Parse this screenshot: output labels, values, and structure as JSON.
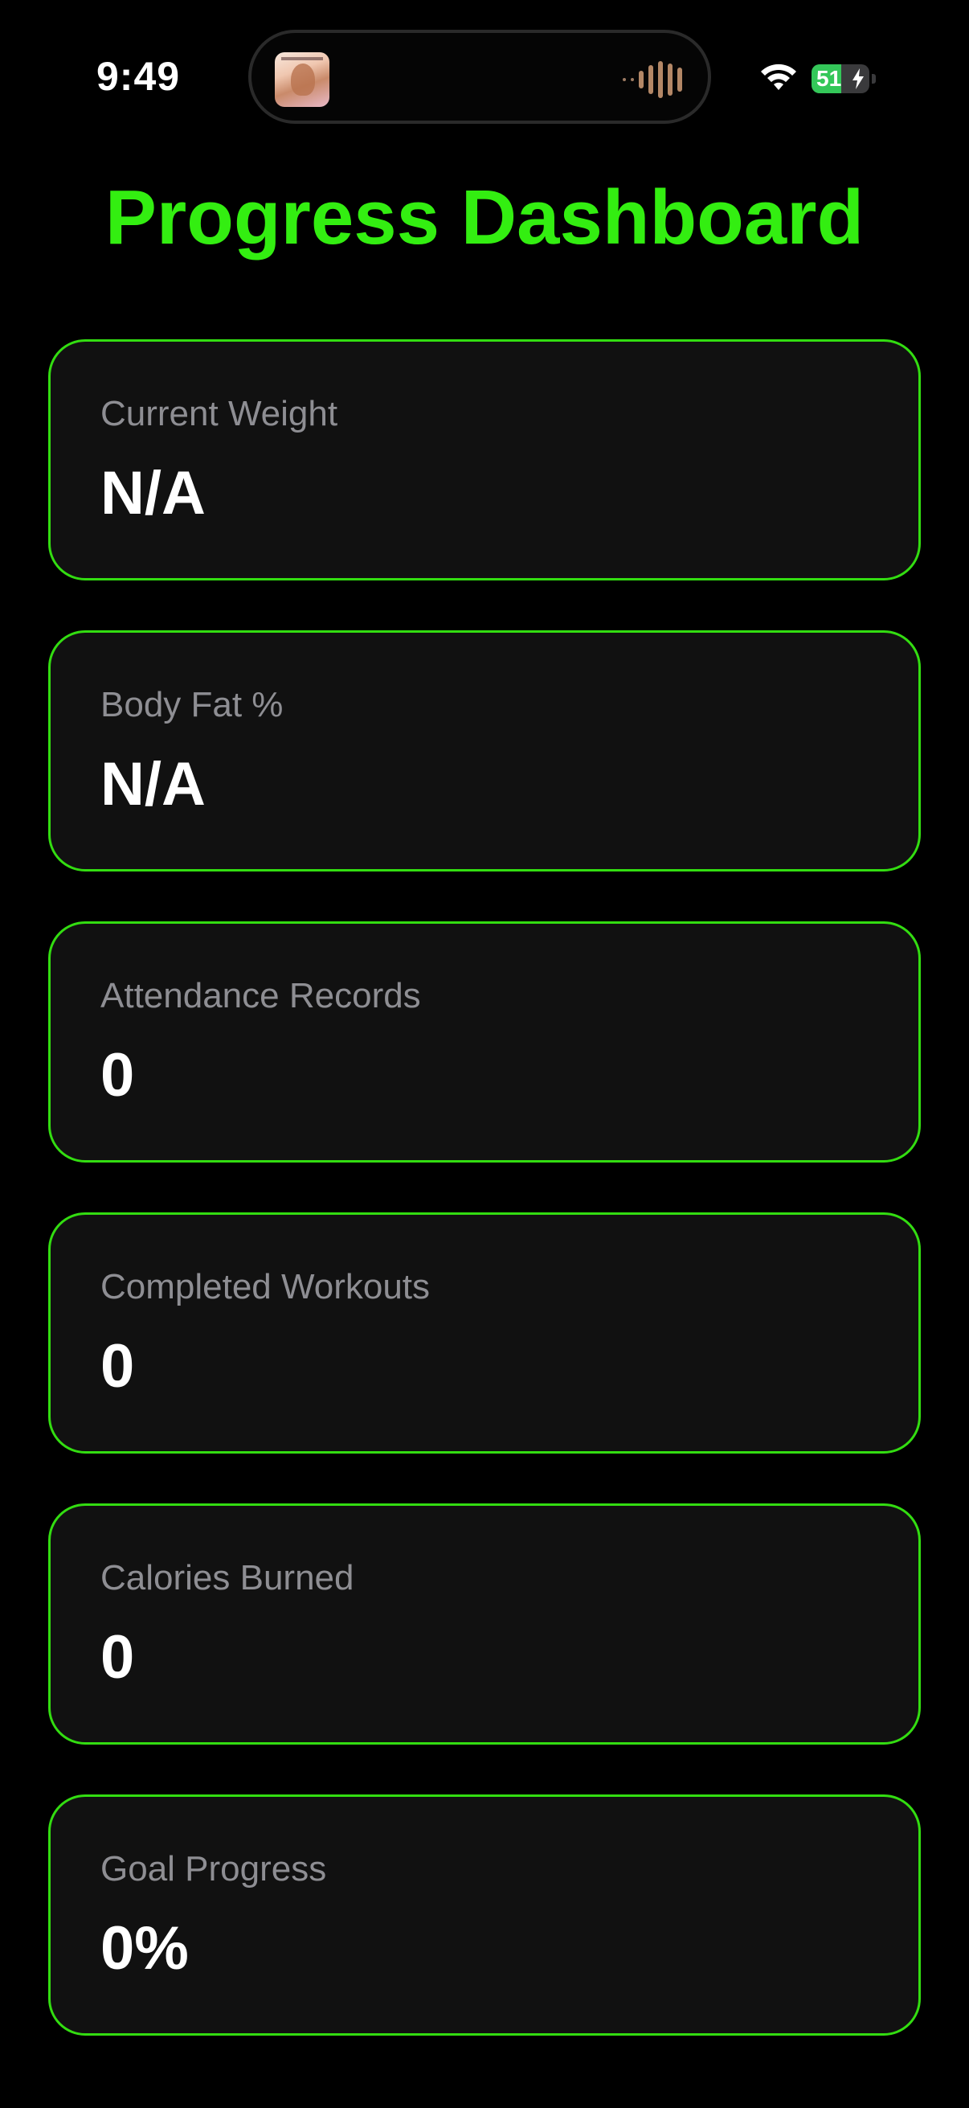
{
  "status_bar": {
    "time": "9:49",
    "battery_level": "51",
    "battery_fraction": 0.51,
    "icons": [
      "now-playing-artwork",
      "audio-waveform-icon",
      "wifi-icon",
      "charging-bolt-icon"
    ]
  },
  "header": {
    "title": "Progress Dashboard",
    "title_color": "#33ee11"
  },
  "accent_color": "#33dd11",
  "cards": [
    {
      "label": "Current Weight",
      "value": "N/A"
    },
    {
      "label": "Body Fat %",
      "value": "N/A"
    },
    {
      "label": "Attendance Records",
      "value": "0"
    },
    {
      "label": "Completed Workouts",
      "value": "0"
    },
    {
      "label": "Calories Burned",
      "value": "0"
    },
    {
      "label": "Goal Progress",
      "value": "0%"
    }
  ]
}
